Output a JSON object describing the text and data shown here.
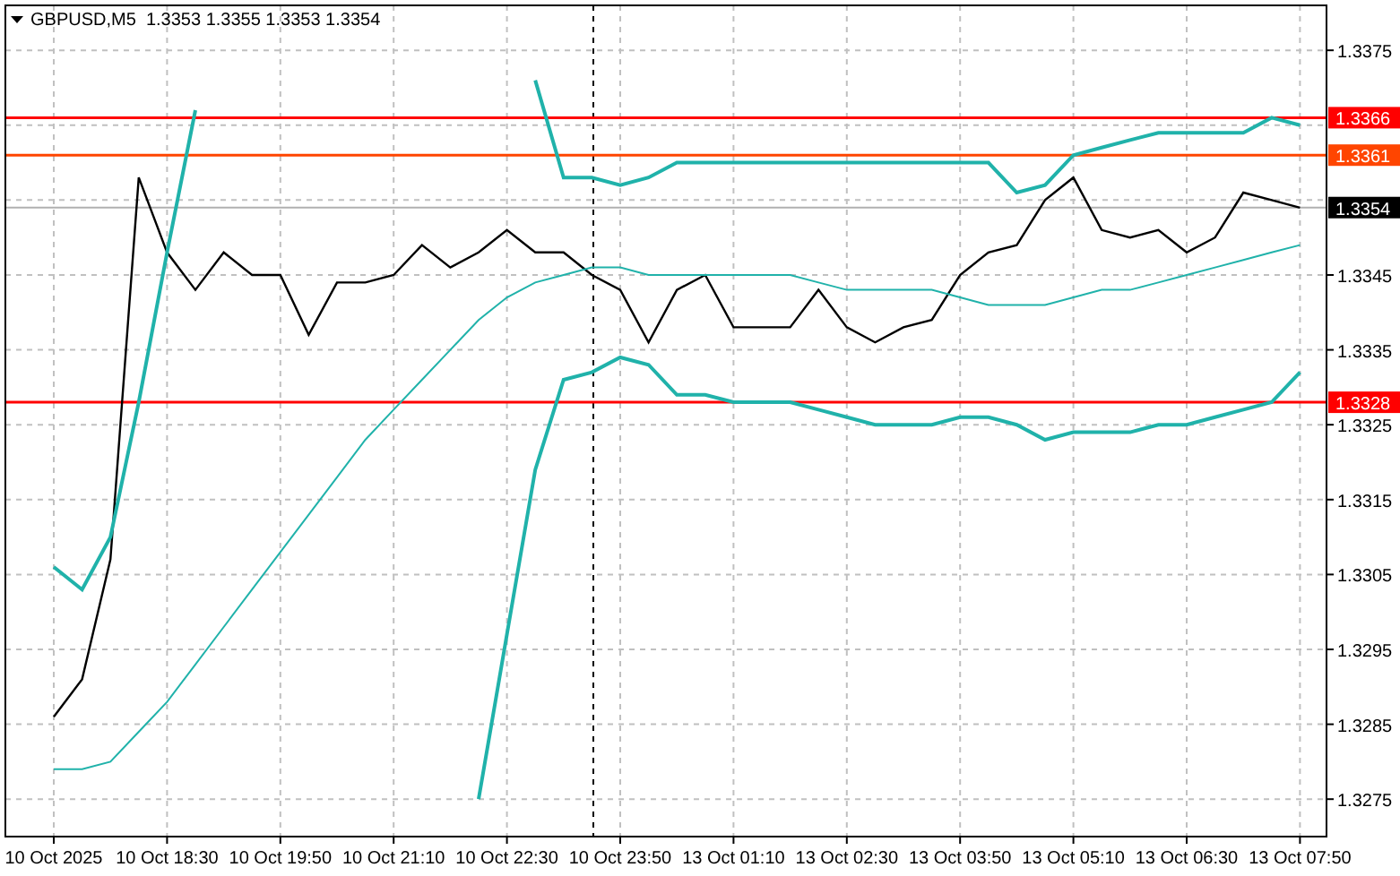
{
  "chart": {
    "chart_data": {
      "type": "line",
      "title": "GBPUSD,M5  1.3353 1.3355 1.3353 1.3354",
      "categories": [
        "10 Oct 2025",
        null,
        null,
        null,
        "10 Oct 18:30",
        null,
        null,
        null,
        "10 Oct 19:50",
        null,
        null,
        null,
        "10 Oct 21:10",
        null,
        null,
        null,
        "10 Oct 22:30",
        null,
        null,
        null,
        "10 Oct 23:50",
        null,
        null,
        null,
        "13 Oct 01:10",
        null,
        null,
        null,
        "13 Oct 02:30",
        null,
        null,
        null,
        "13 Oct 03:50",
        null,
        null,
        null,
        "13 Oct 05:10",
        null,
        null,
        null,
        "13 Oct 06:30",
        null,
        null,
        null,
        "13 Oct 07:50"
      ],
      "series": [
        {
          "color": "#000000",
          "values": [
            1.3286,
            1.3291,
            1.3307,
            1.3358,
            1.3348,
            1.3343,
            1.3348,
            1.3345,
            1.3345,
            1.3337,
            1.3344,
            1.3344,
            1.3345,
            1.3349,
            1.3346,
            1.3348,
            1.3351,
            1.3348,
            1.3348,
            1.3345,
            1.3343,
            1.3336,
            1.3343,
            1.3345,
            1.3338,
            1.3338,
            1.3338,
            1.3343,
            1.3338,
            1.3336,
            1.3338,
            1.3339,
            1.3345,
            1.3348,
            1.3349,
            1.3355,
            1.3358,
            1.3351,
            1.335,
            1.3351,
            1.3348,
            1.335,
            1.3356,
            1.3355,
            1.3354
          ]
        },
        {
          "color": "#20b2aa",
          "values": [
            1.3306,
            1.3303,
            1.331,
            1.3328,
            1.3348,
            1.3367,
            null,
            null,
            null,
            null,
            null,
            null,
            null,
            null,
            null,
            null,
            null,
            1.3371,
            1.3358,
            1.3358,
            1.3357,
            1.3358,
            1.336,
            1.336,
            1.336,
            1.336,
            1.336,
            1.336,
            1.336,
            1.336,
            1.336,
            1.336,
            1.336,
            1.336,
            1.3356,
            1.3357,
            1.3361,
            1.3362,
            1.3363,
            1.3364,
            1.3364,
            1.3364,
            1.3364,
            1.3366,
            1.3365
          ]
        },
        {
          "color": "#20b2aa",
          "values": [
            1.3279,
            1.3279,
            1.328,
            1.3284,
            1.3288,
            1.3293,
            1.3298,
            1.3303,
            1.3308,
            1.3313,
            1.3318,
            1.3323,
            1.3327,
            1.3331,
            1.3335,
            1.3339,
            1.3342,
            1.3344,
            1.3345,
            1.3346,
            1.3346,
            1.3345,
            1.3345,
            1.3345,
            1.3345,
            1.3345,
            1.3345,
            1.3344,
            1.3343,
            1.3343,
            1.3343,
            1.3343,
            1.3342,
            1.3341,
            1.3341,
            1.3341,
            1.3342,
            1.3343,
            1.3343,
            1.3344,
            1.3345,
            1.3346,
            1.3347,
            1.3348,
            1.3349
          ]
        },
        {
          "color": "#20b2aa",
          "values": [
            null,
            null,
            null,
            null,
            null,
            null,
            null,
            null,
            null,
            null,
            null,
            null,
            null,
            null,
            null,
            1.3275,
            1.3297,
            1.3319,
            1.3331,
            1.3332,
            1.3334,
            1.3333,
            1.3329,
            1.3329,
            1.3328,
            1.3328,
            1.3328,
            1.3327,
            1.3326,
            1.3325,
            1.3325,
            1.3325,
            1.3326,
            1.3326,
            1.3325,
            1.3323,
            1.3324,
            1.3324,
            1.3324,
            1.3325,
            1.3325,
            1.3326,
            1.3327,
            1.3328,
            1.3332
          ]
        }
      ],
      "ylim": [
        1.327,
        1.3381
      ],
      "yticks": [
        {
          "value": 1.3375,
          "label": "1.3375"
        },
        {
          "value": 1.3345,
          "label": "1.3345"
        },
        {
          "value": 1.3335,
          "label": "1.3335"
        },
        {
          "value": 1.3325,
          "label": "1.3325"
        },
        {
          "value": 1.3315,
          "label": "1.3315"
        },
        {
          "value": 1.3305,
          "label": "1.3305"
        },
        {
          "value": 1.3295,
          "label": "1.3295"
        },
        {
          "value": 1.3285,
          "label": "1.3285"
        },
        {
          "value": 1.3275,
          "label": "1.3275"
        }
      ],
      "grid": true,
      "ref_lines": [
        {
          "axis": "y",
          "value": 1.3366,
          "label": "1.3366",
          "color": "#ff0000"
        },
        {
          "axis": "y",
          "value": 1.3361,
          "label": "1.3361",
          "color": "#ff4500"
        },
        {
          "axis": "y",
          "value": 1.3354,
          "color": "#b0b0b0"
        },
        {
          "axis": "y",
          "value": 1.3328,
          "label": "1.3328",
          "color": "#ff0000"
        }
      ]
    },
    "bid_tag": "1.3354"
  }
}
